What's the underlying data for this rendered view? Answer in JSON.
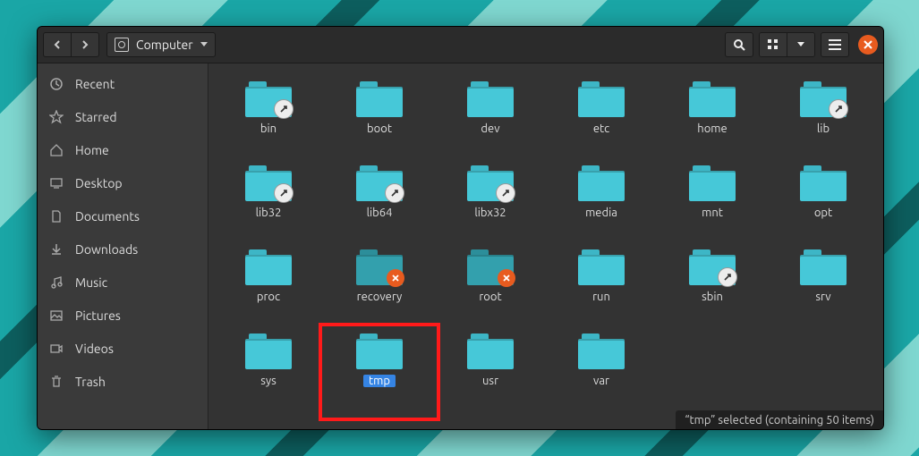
{
  "header": {
    "path_label": "Computer"
  },
  "sidebar": {
    "items": [
      {
        "label": "Recent",
        "icon": "clock-icon"
      },
      {
        "label": "Starred",
        "icon": "star-icon"
      },
      {
        "label": "Home",
        "icon": "home-icon"
      },
      {
        "label": "Desktop",
        "icon": "desktop-icon"
      },
      {
        "label": "Documents",
        "icon": "documents-icon"
      },
      {
        "label": "Downloads",
        "icon": "downloads-icon"
      },
      {
        "label": "Music",
        "icon": "music-icon"
      },
      {
        "label": "Pictures",
        "icon": "pictures-icon"
      },
      {
        "label": "Videos",
        "icon": "videos-icon"
      },
      {
        "label": "Trash",
        "icon": "trash-icon"
      }
    ]
  },
  "folders": [
    {
      "name": "bin",
      "badge": "link"
    },
    {
      "name": "boot"
    },
    {
      "name": "dev"
    },
    {
      "name": "etc"
    },
    {
      "name": "home"
    },
    {
      "name": "lib",
      "badge": "link"
    },
    {
      "name": "lib32",
      "badge": "link"
    },
    {
      "name": "lib64",
      "badge": "link"
    },
    {
      "name": "libx32",
      "badge": "link"
    },
    {
      "name": "media"
    },
    {
      "name": "mnt"
    },
    {
      "name": "opt"
    },
    {
      "name": "proc"
    },
    {
      "name": "recovery",
      "badge": "denied",
      "dim": true
    },
    {
      "name": "root",
      "badge": "denied",
      "dim": true
    },
    {
      "name": "run"
    },
    {
      "name": "sbin",
      "badge": "link"
    },
    {
      "name": "srv"
    },
    {
      "name": "sys"
    },
    {
      "name": "tmp",
      "selected": true,
      "highlighted": true
    },
    {
      "name": "usr"
    },
    {
      "name": "var"
    }
  ],
  "status": {
    "text": "“tmp” selected  (containing 50 items)"
  }
}
